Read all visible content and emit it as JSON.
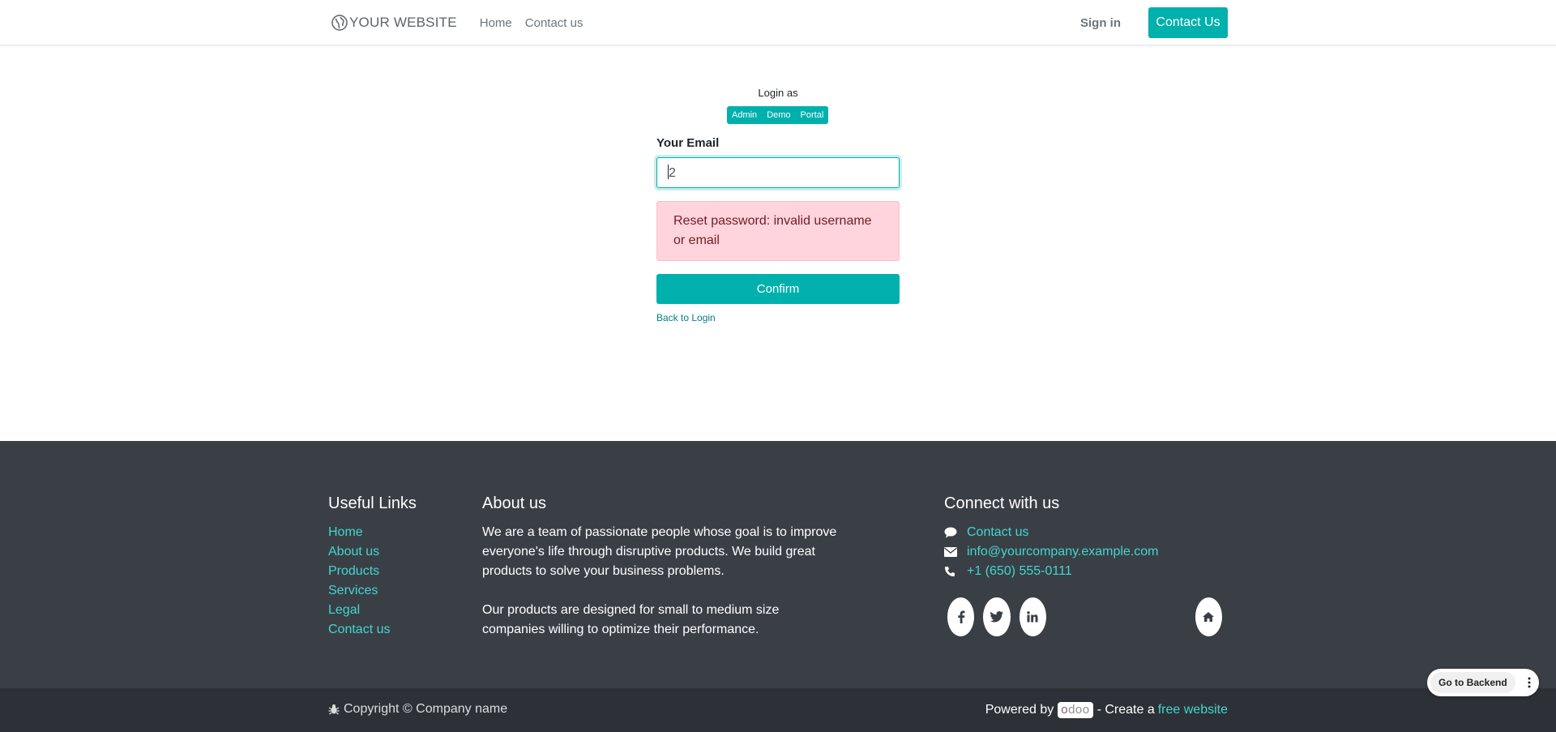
{
  "header": {
    "brand": "YOUR WEBSITE",
    "nav": [
      {
        "label": "Home"
      },
      {
        "label": "Contact us"
      }
    ],
    "signin_label": "Sign in",
    "contact_button": "Contact Us"
  },
  "login": {
    "login_as_label": "Login as",
    "demo_buttons": [
      "Admin",
      "Demo",
      "Portal"
    ],
    "email_label": "Your Email",
    "email_value": "2",
    "alert_text": "Reset password: invalid username or email",
    "confirm_label": "Confirm",
    "back_link": "Back to Login"
  },
  "footer": {
    "useful_links": {
      "title": "Useful Links",
      "items": [
        "Home",
        "About us",
        "Products",
        "Services",
        "Legal",
        "Contact us"
      ]
    },
    "about": {
      "title": "About us",
      "p1": "We are a team of passionate people whose goal is to improve everyone's life through disruptive products. We build great products to solve your business problems.",
      "p2": "Our products are designed for small to medium size companies willing to optimize their performance."
    },
    "connect": {
      "title": "Connect with us",
      "contact": "Contact us",
      "email": "info@yourcompany.example.com",
      "phone": "+1 (650) 555-0111",
      "social_icons": [
        "facebook-icon",
        "twitter-icon",
        "linkedin-icon",
        "home-icon"
      ]
    },
    "copyright": "Copyright © Company name",
    "powered_by": "Powered by",
    "odoo_logo": "odoo",
    "create_text": "- Create a",
    "free_website": "free website"
  },
  "backend": {
    "go_label": "Go to Backend"
  },
  "colors": {
    "primary": "#00b0ad",
    "footer_bg": "#3a3f46",
    "copyright_bg": "#2d3137",
    "link": "#41d6ce",
    "alert_bg": "#ffd4dc",
    "alert_text": "#721c24"
  }
}
